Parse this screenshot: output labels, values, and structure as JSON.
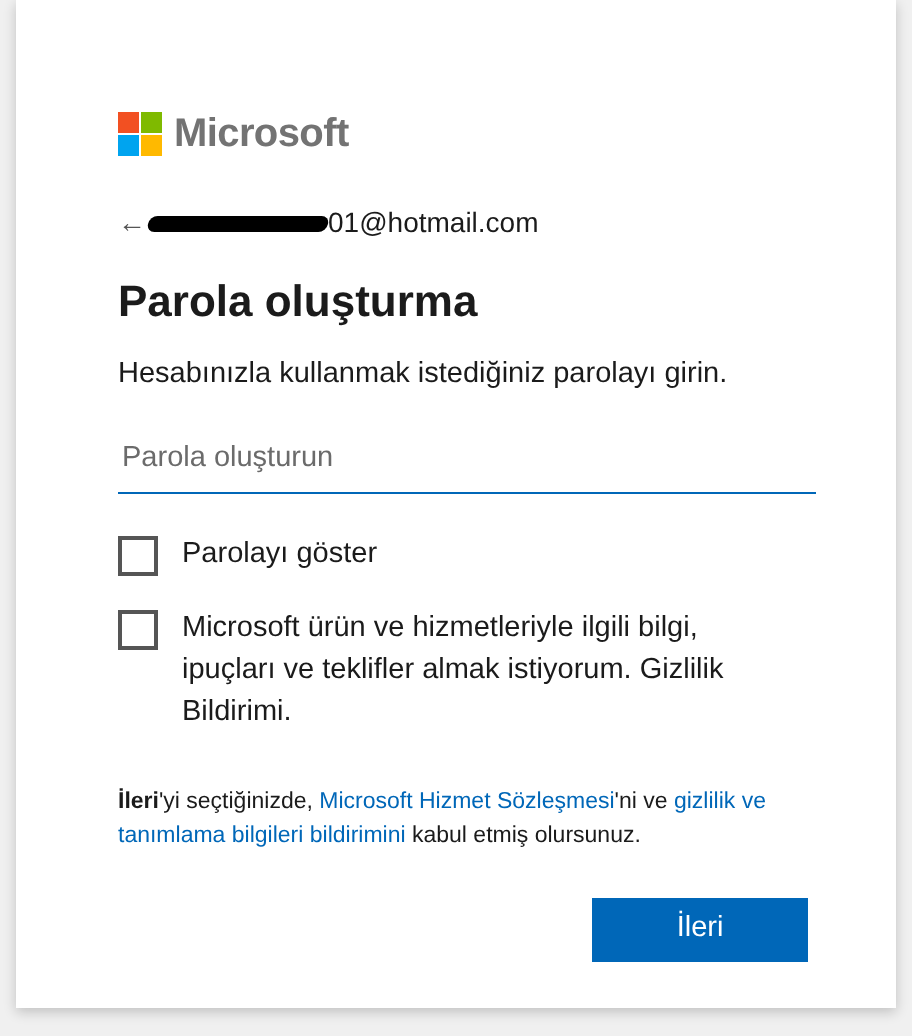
{
  "logo": {
    "text": "Microsoft"
  },
  "identity": {
    "back": "←",
    "email": "01@hotmail.com"
  },
  "title": "Parola oluşturma",
  "description": "Hesabınızla kullanmak istediğiniz parolayı girin.",
  "password_field": {
    "placeholder": "Parola oluşturun"
  },
  "checkboxes": [
    {
      "label": "Parolayı göster",
      "checked": false
    },
    {
      "label": "Microsoft ürün ve hizmetleriyle ilgili bilgi, ipuçları ve teklifler almak istiyorum. Gizlilik Bildirimi.",
      "checked": false
    }
  ],
  "legal": [
    {
      "kind": "bold",
      "text": "İleri"
    },
    {
      "kind": "text",
      "text": "'yi seçtiğinizde, "
    },
    {
      "kind": "link",
      "text": "Microsoft Hizmet Sözleşmesi"
    },
    {
      "kind": "text",
      "text": "'ni ve "
    },
    {
      "kind": "link",
      "text": "gizlilik ve"
    },
    {
      "kind": "link",
      "text": "tanımlama bilgileri bildirimini"
    },
    {
      "kind": "text",
      "text": " kabul etmiş olursunuz."
    }
  ],
  "next_button": "İleri"
}
